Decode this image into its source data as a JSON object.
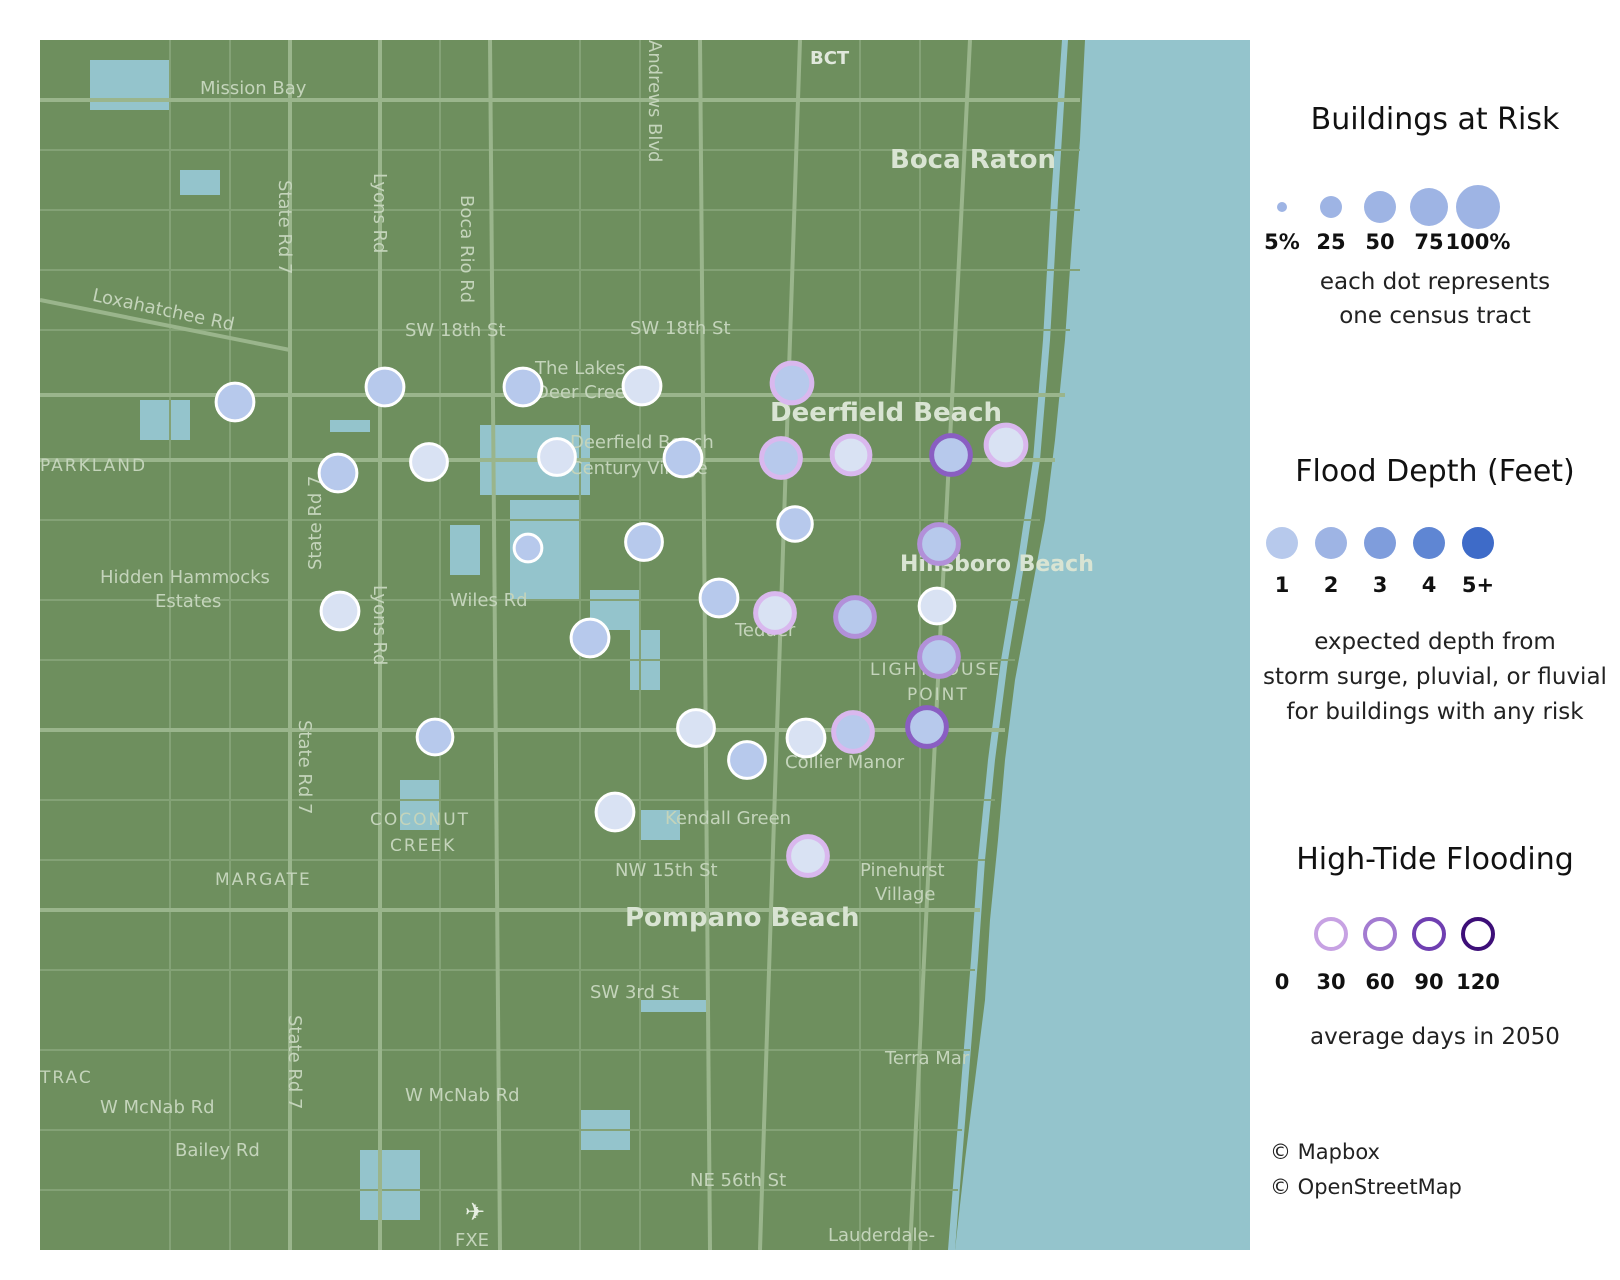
{
  "map": {
    "places": {
      "mission_bay": "Mission Bay",
      "boca_raton": "Boca Raton",
      "bct": "BCT",
      "andrews_blvd": "Andrews Blvd",
      "state_rd7_a": "State Rd 7",
      "lyons_rd_a": "Lyons Rd",
      "boca_rio_rd": "Boca Rio Rd",
      "loxahatchee_rd": "Loxahatchee Rd",
      "sw18th_a": "SW 18th St",
      "sw18th_b": "SW 18th St",
      "the_lakes": "The Lakes",
      "deer_creek": "Deer Creek",
      "deerfield_beach": "Deerfield Beach",
      "parkland": "PARKLAND",
      "state_rd7_b": "State Rd 7",
      "deerfield_cc": "Deerfield Beach",
      "century_village": "Century Village",
      "hidden_hammocks": "Hidden Hammocks",
      "estates": "Estates",
      "wiles_rd": "Wiles Rd",
      "lyons_rd_b": "Lyons Rd",
      "hillsboro_beach": "Hillsboro Beach",
      "tedder": "Tedder",
      "lighthouse": "LIGHTHOUSE",
      "point": "POINT",
      "state_rd7_c": "State Rd 7",
      "collier_manor": "Collier Manor",
      "coconut": "COCONUT",
      "creek": "CREEK",
      "kendall_green": "Kendall Green",
      "margate": "MARGATE",
      "nw15th": "NW 15th St",
      "pinehurst": "Pinehurst",
      "village": "Village",
      "pompano_beach": "Pompano Beach",
      "sw3rd": "SW 3rd St",
      "terra_mar": "Terra Mar",
      "state_rd7_d": "State Rd 7",
      "trac": "TRAC",
      "w_mcnab_a": "W McNab Rd",
      "w_mcnab_b": "W McNab Rd",
      "bailey_rd": "Bailey Rd",
      "ne56th": "NE 56th St",
      "lauderdale": "Lauderdale-",
      "fxe": "FXE"
    },
    "colors": {
      "land": "#6e8f5e",
      "water": "#94c4cc",
      "road": "#8aa77b",
      "major_road": "#9ab58c",
      "dot_stroke": "#ffffff"
    },
    "depth_colors": [
      "#d9e2f3",
      "#b7c9ec",
      "#9eb4e4",
      "#8aa7df",
      "#5a85d4"
    ],
    "tide_colors": [
      "#ffffff",
      "#d9b8ee",
      "#b290d9",
      "#8a5ec2",
      "#4b1f82"
    ],
    "tracts": [
      {
        "risk": 50,
        "depth": 2,
        "tide": 0
      },
      {
        "risk": 50,
        "depth": 2,
        "tide": 0
      },
      {
        "risk": 50,
        "depth": 2,
        "tide": 0
      },
      {
        "risk": 50,
        "depth": 1,
        "tide": 0
      },
      {
        "risk": 60,
        "depth": 2,
        "tide": 30
      },
      {
        "risk": 50,
        "depth": 2,
        "tide": 0
      },
      {
        "risk": 45,
        "depth": 1,
        "tide": 0
      },
      {
        "risk": 45,
        "depth": 1,
        "tide": 0
      },
      {
        "risk": 50,
        "depth": 2,
        "tide": 0
      },
      {
        "risk": 55,
        "depth": 2,
        "tide": 30
      },
      {
        "risk": 50,
        "depth": 1,
        "tide": 30
      },
      {
        "risk": 55,
        "depth": 2,
        "tide": 90
      },
      {
        "risk": 60,
        "depth": 1,
        "tide": 30
      },
      {
        "risk": 12,
        "depth": 2,
        "tide": 0
      },
      {
        "risk": 45,
        "depth": 2,
        "tide": 0
      },
      {
        "risk": 35,
        "depth": 2,
        "tide": 0
      },
      {
        "risk": 55,
        "depth": 2,
        "tide": 60
      },
      {
        "risk": 50,
        "depth": 1,
        "tide": 0
      },
      {
        "risk": 50,
        "depth": 2,
        "tide": 0
      },
      {
        "risk": 50,
        "depth": 2,
        "tide": 0
      },
      {
        "risk": 55,
        "depth": 1,
        "tide": 30
      },
      {
        "risk": 55,
        "depth": 2,
        "tide": 60
      },
      {
        "risk": 40,
        "depth": 1,
        "tide": 0
      },
      {
        "risk": 55,
        "depth": 2,
        "tide": 60
      },
      {
        "risk": 40,
        "depth": 2,
        "tide": 0
      },
      {
        "risk": 45,
        "depth": 1,
        "tide": 0
      },
      {
        "risk": 45,
        "depth": 2,
        "tide": 0
      },
      {
        "risk": 50,
        "depth": 1,
        "tide": 0
      },
      {
        "risk": 55,
        "depth": 2,
        "tide": 30
      },
      {
        "risk": 55,
        "depth": 2,
        "tide": 90
      },
      {
        "risk": 50,
        "depth": 1,
        "tide": 0
      },
      {
        "risk": 55,
        "depth": 1,
        "tide": 30
      }
    ]
  },
  "legend": {
    "risk": {
      "title": "Buildings at Risk",
      "labels": [
        "5%",
        "25",
        "50",
        "75",
        "100%"
      ],
      "note_line1": "each dot represents",
      "note_line2": "one census tract"
    },
    "depth": {
      "title": "Flood Depth (Feet)",
      "labels": [
        "1",
        "2",
        "3",
        "4",
        "5+"
      ],
      "colors": [
        "#b7c9ec",
        "#9eb4e4",
        "#7f9ddc",
        "#5f86d3",
        "#3e6bc8"
      ],
      "note_line1": "expected depth from",
      "note_line2": "storm surge, pluvial, or fluvial",
      "note_line3": "for buildings with any risk"
    },
    "tide": {
      "title": "High-Tide Flooding",
      "labels": [
        "0",
        "30",
        "60",
        "90",
        "120"
      ],
      "colors": [
        "#ffffff",
        "#c7a2e3",
        "#a37bd1",
        "#6f3fb1",
        "#3d0f78"
      ],
      "note": "average days in 2050"
    },
    "attribution": {
      "mapbox": "© Mapbox",
      "osm": "© OpenStreetMap"
    }
  }
}
